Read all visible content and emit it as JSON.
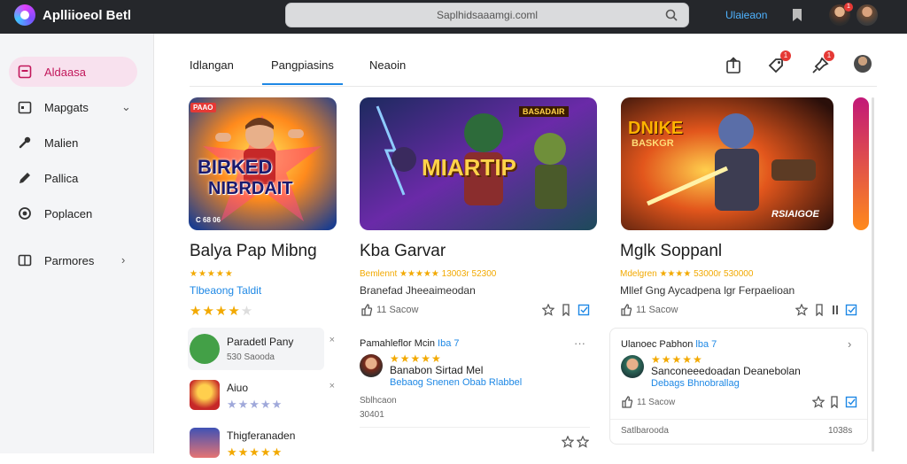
{
  "app": {
    "title": "Aplliioeol Betl",
    "logo_icon": "app-logo-icon"
  },
  "search": {
    "text": "Saplhidsaaamgi.coml"
  },
  "topbar": {
    "link": "Ulaieaon",
    "badge": "1"
  },
  "sidebar": {
    "items": [
      {
        "label": "Aldaasa",
        "icon": "dashboard-icon",
        "active": true
      },
      {
        "label": "Mapgats",
        "icon": "calendar-icon",
        "chevron": true
      },
      {
        "label": "Malien",
        "icon": "wrench-icon"
      },
      {
        "label": "Pallica",
        "icon": "pen-icon"
      },
      {
        "label": "Poplacen",
        "icon": "circle-icon"
      },
      {
        "label": "Parmores",
        "icon": "grid-icon",
        "chevron": true
      }
    ]
  },
  "tabs": [
    {
      "label": "Idlangan"
    },
    {
      "label": "Pangpiasins",
      "active": true
    },
    {
      "label": "Neaoin"
    }
  ],
  "header_badges": [
    "1",
    "1"
  ],
  "cards": [
    {
      "image_badge": "PAAO",
      "image_title_1": "BIRKED",
      "image_title_2": "NIBRDAIT",
      "image_foot": "C 68 06",
      "title": "Balya Pap Mibng",
      "meta_stars": "★★★★★",
      "meta_text": "",
      "desc": "Tlbeaong Taldit",
      "rating": 4,
      "count": ""
    },
    {
      "image_title_1": "MIARTIP",
      "image_badge": "BASADAIR",
      "title": "Kba Garvar",
      "meta_stars": "",
      "meta_text": "Bemlennt ★★★★★ 13003r 52300",
      "desc": "Branefad Jheeaimeodan",
      "rating": 0,
      "count": "11 Sacow"
    },
    {
      "image_title_1": "DNIKE",
      "image_title_2": "BASKGR",
      "image_foot": "RSIAIGOE",
      "title": "Mglk Soppanl",
      "meta_stars": "",
      "meta_text": "Mdelgren ★★★★ 53000r 530000",
      "desc": "Mllef Gng Aycadpena lgr Ferpaelioan",
      "rating": 0,
      "count": "11 Sacow"
    }
  ],
  "list": [
    {
      "title": "Paradetl Pany",
      "sub": "530 Saooda",
      "active": true,
      "close": "×"
    },
    {
      "title": "Aiuo",
      "stars": "★★★★★",
      "close": "×"
    },
    {
      "title": "Thigferanaden",
      "stars": "★★★★★",
      "close": ""
    }
  ],
  "reviews": [
    {
      "head": "Pamahleflor Mcin",
      "head_accent": "Iba 7",
      "stars": "★★★★★",
      "text": "Banabon Sirtad Mel",
      "link": "Bebaog Snenen Obab Rlabbel",
      "small1": "Sblhcaon",
      "small2": "30401",
      "more": "···"
    },
    {
      "head": "Ulanoec Pabhon",
      "head_accent": "lba 7",
      "stars": "★★★★★",
      "text": "Sanconeeedoadan Deanebolan",
      "link": "Debags Bhnobrallag",
      "small1": "11 Sacow",
      "footer_left": "Satlbarooda",
      "footer_right": "1038s",
      "more": "›"
    }
  ]
}
